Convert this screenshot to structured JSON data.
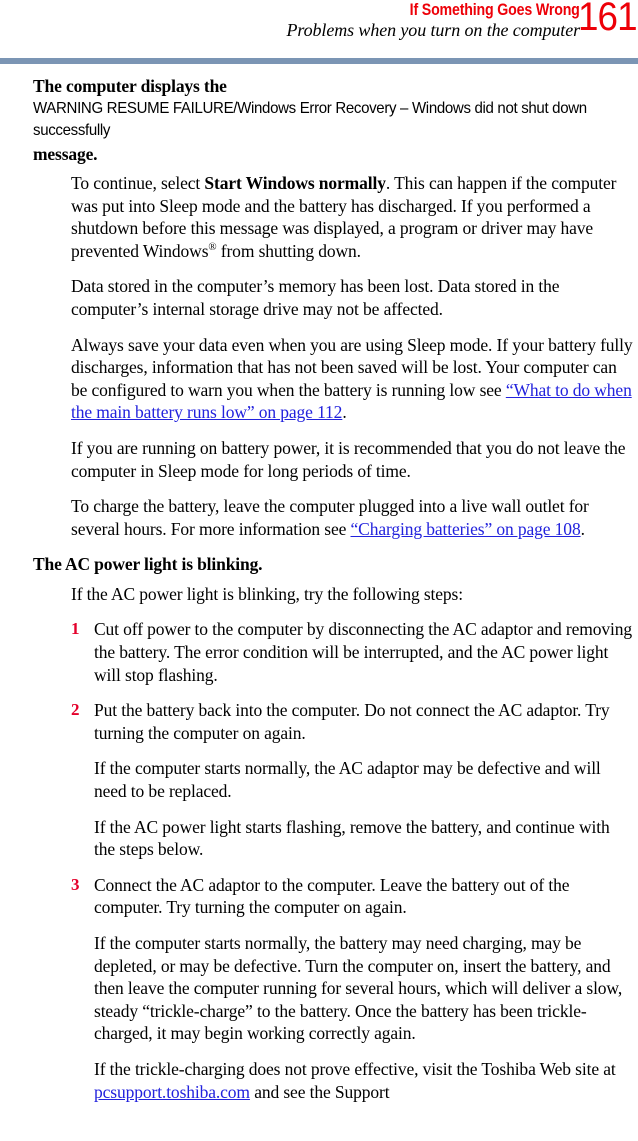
{
  "page": {
    "number": "161",
    "chapter_title": "If Something Goes Wrong",
    "section_title": "Problems when you turn on the computer",
    "rule_color": "#7B95B4",
    "accent_red": "#ED0008",
    "number_red": "#E4002B",
    "link_blue": "#2222DD"
  },
  "topics": [
    {
      "heading_lead": "The computer displays the ",
      "heading_ui": "WARNING RESUME FAILURE/Windows Error Recovery – Windows did not shut down successfully ",
      "heading_tail": "message.",
      "paragraphs": [
        {
          "pre": "To continue, select ",
          "bold": "Start Windows normally",
          "post": ". This can happen if the computer was put into Sleep mode and the battery has discharged. If you performed a shutdown before this message was displayed, a program or driver may have prevented Windows",
          "sup": "®",
          "post2": " from shutting down."
        },
        {
          "text": "Data stored in the computer’s memory has been lost. Data stored in the computer’s internal storage drive may not be affected."
        },
        {
          "pre": "Always save your data even when you are using Sleep mode. If your battery fully discharges, information that has not been saved will be lost. Your computer can be configured to warn you when the battery is running low see ",
          "link": "“What to do when the main battery runs low” on page 112",
          "post": "."
        },
        {
          "text": "If you are running on battery power, it is recommended that you do not leave the computer in Sleep mode for long periods of time."
        },
        {
          "pre": "To charge the battery, leave the computer plugged into a live wall outlet for several hours. For more information see ",
          "link": "“Charging batteries” on page 108",
          "post": "."
        }
      ]
    },
    {
      "heading": "The AC power light is blinking.",
      "intro": "If the AC power light is blinking, try the following steps:",
      "steps": [
        {
          "number": "1",
          "text": "Cut off power to the computer by disconnecting the AC adaptor and removing the battery. The error condition will be interrupted, and the AC power light will stop flashing.",
          "followups": []
        },
        {
          "number": "2",
          "text": "Put the battery back into the computer. Do not connect the AC adaptor. Try turning the computer on again.",
          "followups": [
            "If the computer starts normally, the AC adaptor may be defective and will need to be replaced.",
            "If the AC power light starts flashing, remove the battery, and continue with the steps below."
          ]
        },
        {
          "number": "3",
          "text": "Connect the AC adaptor to the computer. Leave the battery out of the computer. Try turning the computer on again.",
          "followups": [
            "If the computer starts normally, the battery may need charging, may be depleted, or may be defective. Turn the computer on, insert the battery, and then leave the computer running for several hours, which will deliver a slow, steady “trickle-charge” to the battery. Once the battery has been trickle-charged, it may begin working correctly again."
          ],
          "final": {
            "pre": "If the trickle-charging does not prove effective, visit the Toshiba Web site at ",
            "link": "pcsupport.toshiba.com",
            "post": " and see the Support"
          }
        }
      ]
    }
  ]
}
